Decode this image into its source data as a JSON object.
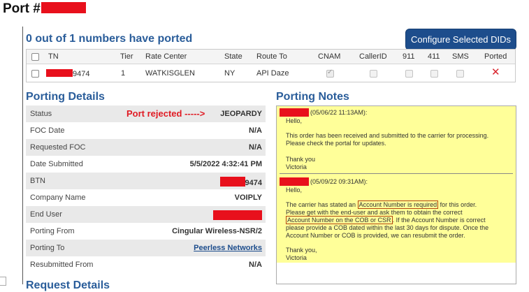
{
  "page": {
    "title": "Port #"
  },
  "numbers": {
    "heading": "0 out of 1 numbers have ported",
    "configure_button": "Configure Selected DIDs",
    "columns": [
      "TN",
      "Tier",
      "Rate Center",
      "State",
      "Route To",
      "CNAM",
      "CallerID",
      "911",
      "411",
      "SMS",
      "Ported"
    ],
    "row": {
      "tn_suffix": "9474",
      "tier": "1",
      "rate_center": "WATKISGLEN",
      "state": "NY",
      "route_to": "API Daze",
      "ported": "✕"
    }
  },
  "details": {
    "heading": "Porting Details",
    "rejected_note": "Port rejected ----->",
    "rows": [
      {
        "label": "Status",
        "value": "JEOPARDY"
      },
      {
        "label": "FOC Date",
        "value": "N/A"
      },
      {
        "label": "Requested FOC",
        "value": "N/A"
      },
      {
        "label": "Date Submitted",
        "value": "5/5/2022 4:32:41 PM"
      },
      {
        "label": "BTN",
        "value": "9474"
      },
      {
        "label": "Company Name",
        "value": "VOIPLY"
      },
      {
        "label": "End User",
        "value": ""
      },
      {
        "label": "Porting From",
        "value": "Cingular Wireless-NSR/2"
      },
      {
        "label": "Porting To",
        "value": "Peerless Networks"
      },
      {
        "label": "Resubmitted From",
        "value": "N/A"
      }
    ]
  },
  "notes": {
    "heading": "Porting Notes",
    "note1": {
      "timestamp": "(05/06/22 11:13AM):",
      "greeting": "Hello,",
      "body": "This order has been received and submitted to the carrier for processing. Please check the portal for updates.",
      "closing": "Thank you",
      "signature": "Victoria"
    },
    "note2": {
      "timestamp": "(05/09/22 09:31AM):",
      "greeting": "Hello,",
      "line1_pre": "The carrier has stated an ",
      "line1_hl": "Account Number is required",
      "line1_post": " for this order.",
      "line2": "Please get with the end-user and ask them to obtain the correct",
      "line3_hl": "Account Number on the COB or CSR",
      "line3_post": ". If the Account Number is correct",
      "line4": "please provide a COB dated within the last 30 days for dispute. Once the",
      "line5": "Account Number or COB is provided, we can resubmit the order.",
      "closing": "Thank you,",
      "signature": "Victoria"
    }
  },
  "request": {
    "heading": "Request Details"
  },
  "colors": {
    "heading_blue": "#2a5d9a",
    "button_blue": "#1d4d8c",
    "redaction": "#e8101c",
    "notes_bg": "#ffff99",
    "reject_red": "#e01b24"
  }
}
